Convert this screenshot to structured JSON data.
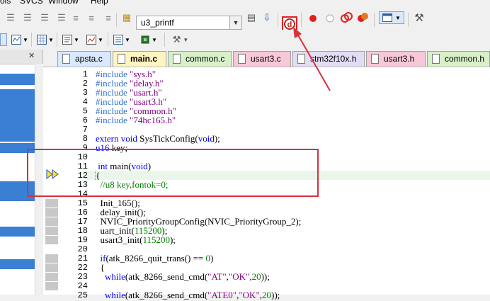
{
  "menu": {
    "items": [
      "ols",
      "SVCS",
      "Window",
      "Help"
    ]
  },
  "toolbar": {
    "target_name": "u3_printf"
  },
  "tabs": [
    {
      "label": "apsta.c",
      "color": "#d8e8ff"
    },
    {
      "label": "main.c",
      "color": "#fff5c0",
      "active": true
    },
    {
      "label": "common.c",
      "color": "#d8f0c8"
    },
    {
      "label": "usart3.c",
      "color": "#f7c8d8"
    },
    {
      "label": "stm32f10x.h",
      "color": "#e4dcf4"
    },
    {
      "label": "usart3.h",
      "color": "#f7c8d8"
    },
    {
      "label": "common.h",
      "color": "#d8f0c8"
    }
  ],
  "code": {
    "lines": [
      {
        "n": "1",
        "t": "#include \"sys.h\""
      },
      {
        "n": "2",
        "t": "#include \"delay.h\""
      },
      {
        "n": "3",
        "t": "#include \"usart.h\""
      },
      {
        "n": "4",
        "t": "#include \"usart3.h\""
      },
      {
        "n": "5",
        "t": "#include \"common.h\""
      },
      {
        "n": "6",
        "t": "#include \"74hc165.h\""
      },
      {
        "n": "7",
        "t": ""
      },
      {
        "n": "8",
        "t": "extern void SysTickConfig(void);"
      },
      {
        "n": "9",
        "t": "u16 key;"
      },
      {
        "n": "10",
        "t": ""
      },
      {
        "n": "11",
        "t": " int main(void)"
      },
      {
        "n": "12",
        "t": "{"
      },
      {
        "n": "13",
        "t": "  //u8 key,fontok=0;"
      },
      {
        "n": "14",
        "t": ""
      },
      {
        "n": "15",
        "t": "  Init_165();"
      },
      {
        "n": "16",
        "t": "  delay_init();"
      },
      {
        "n": "17",
        "t": "  NVIC_PriorityGroupConfig(NVIC_PriorityGroup_2);"
      },
      {
        "n": "18",
        "t": "  uart_init(115200);"
      },
      {
        "n": "19",
        "t": "  usart3_init(115200);"
      },
      {
        "n": "20",
        "t": ""
      },
      {
        "n": "21",
        "t": "  if(atk_8266_quit_trans() == 0)"
      },
      {
        "n": "22",
        "t": "  {"
      },
      {
        "n": "23",
        "t": "    while(atk_8266_send_cmd(\"AT\",\"OK\",20));"
      },
      {
        "n": "24",
        "t": ""
      },
      {
        "n": "25",
        "t": "    while(atk_8266_send_cmd(\"ATE0\",\"OK\",20));"
      }
    ]
  },
  "colors": {
    "preprocessor": "#3070d0",
    "string": "#800080",
    "keyword": "#0000ff",
    "comment": "#008000",
    "annotation": "#d8303a"
  }
}
